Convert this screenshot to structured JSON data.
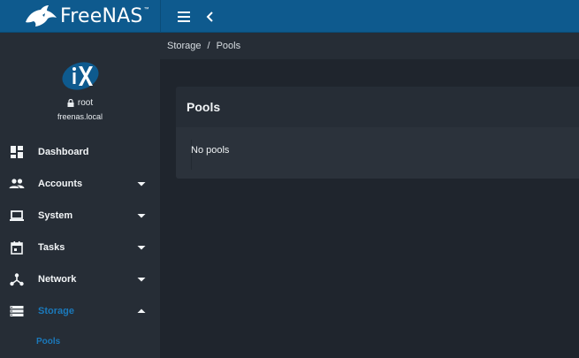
{
  "brand": {
    "name": "FreeNAS",
    "trademark": "™"
  },
  "user": {
    "name": "root",
    "host": "freenas.local"
  },
  "nav": [
    {
      "label": "Dashboard",
      "icon": "dashboard-icon",
      "caret": "none"
    },
    {
      "label": "Accounts",
      "icon": "accounts-icon",
      "caret": "down"
    },
    {
      "label": "System",
      "icon": "laptop-icon",
      "caret": "down"
    },
    {
      "label": "Tasks",
      "icon": "calendar-icon",
      "caret": "down"
    },
    {
      "label": "Network",
      "icon": "network-icon",
      "caret": "down"
    },
    {
      "label": "Storage",
      "icon": "storage-icon",
      "caret": "up",
      "active": true
    }
  ],
  "storage_sub": [
    {
      "label": "Pools"
    }
  ],
  "breadcrumb": {
    "parent": "Storage",
    "separator": "/",
    "current": "Pools"
  },
  "main": {
    "card_title": "Pools",
    "empty_text": "No pools"
  },
  "colors": {
    "topbar": "#0e5a8e",
    "sidebar": "#262d36",
    "content_bg": "#1f252d",
    "card": "#2b323b",
    "accent": "#1b79bb"
  }
}
